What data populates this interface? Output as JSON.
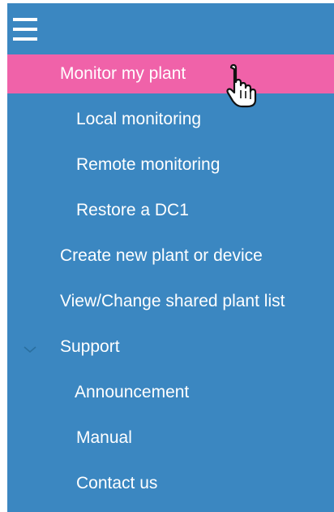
{
  "menu": {
    "hamburger_icon": "hamburger-menu-icon",
    "items": [
      {
        "label": "Monitor my plant",
        "active": true,
        "level": 1
      },
      {
        "label": "Local monitoring",
        "level": 2
      },
      {
        "label": "Remote monitoring",
        "level": 2
      },
      {
        "label": "Restore a DC1",
        "level": 2
      },
      {
        "label": "Create new plant or device",
        "level": 1
      },
      {
        "label": "View/Change shared plant list",
        "level": 1
      },
      {
        "label": "Support",
        "level": 1,
        "expanded": true
      },
      {
        "label": "Announcement",
        "level": 2
      },
      {
        "label": "Manual",
        "level": 2
      },
      {
        "label": "Contact us",
        "level": 2
      }
    ]
  },
  "colors": {
    "panel": "#3b87c1",
    "active": "#f062a9",
    "text": "#ffffff"
  },
  "icons": {
    "chevron": "chevron-down-icon",
    "cursor": "hand-pointer-icon"
  }
}
